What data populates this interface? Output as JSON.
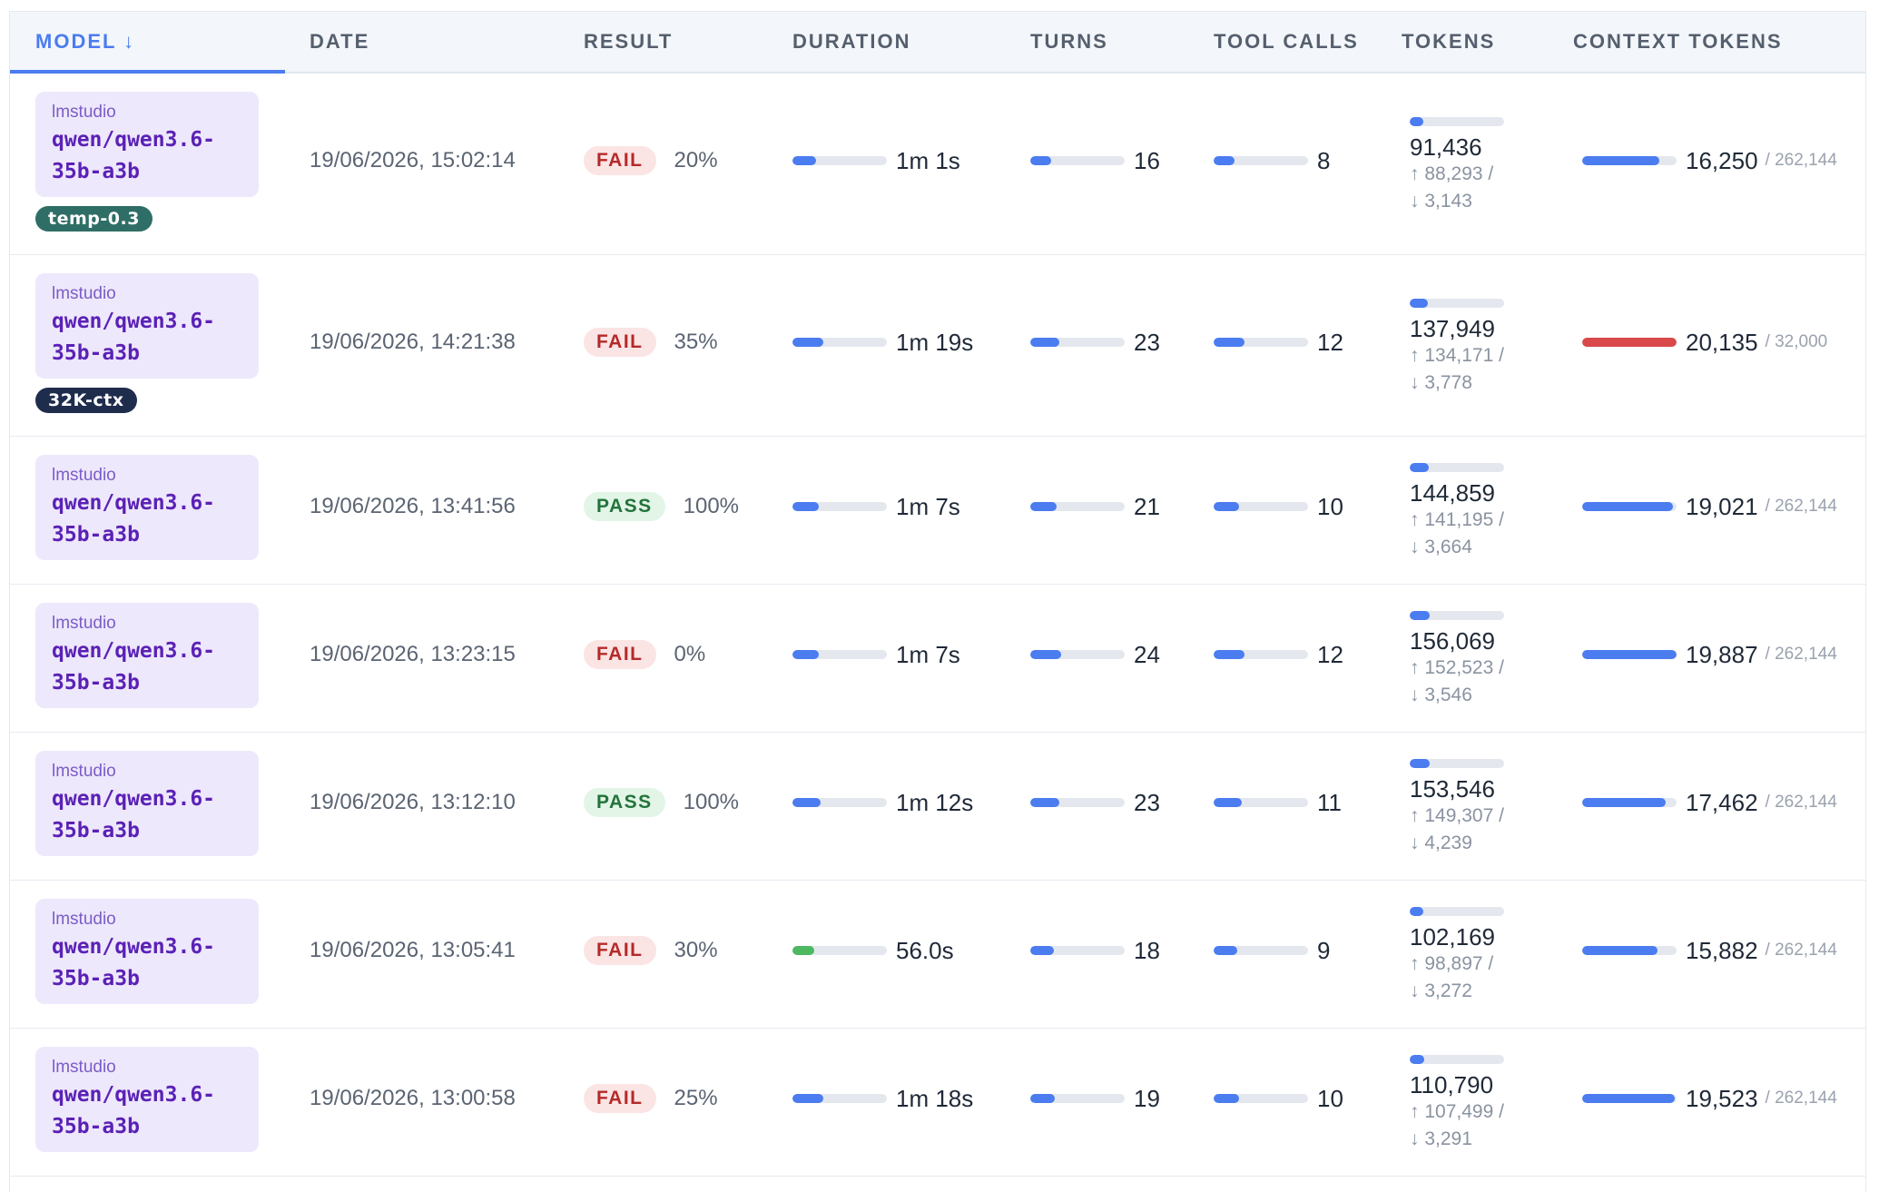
{
  "header": {
    "model_label": "MODEL ↓",
    "date_label": "DATE",
    "result_label": "RESULT",
    "duration_label": "DURATION",
    "turns_label": "TURNS",
    "tool_calls_label": "TOOL CALLS",
    "tokens_label": "TOKENS",
    "context_tokens_label": "CONTEXT TOKENS"
  },
  "colors": {
    "accent": "#4b7cf0",
    "fail_bg": "#fbe4e4",
    "fail_text": "#b52a2a",
    "pass_bg": "#e2f5e7",
    "pass_text": "#23743a",
    "model_card_bg": "#ede8fb",
    "context_over_limit": "#d9484a",
    "duration_fast": "#4cb860"
  },
  "runs": [
    {
      "provider": "lmstudio",
      "model_line1": "qwen/qwen3.6-",
      "model_line2": "35b-a3b",
      "tag": "temp-0.3",
      "tag_color": "#2f6e66",
      "date": "19/06/2026, 15:02:14",
      "result": "FAIL",
      "score": "20%",
      "duration": "1m 1s",
      "duration_fraction": 0.25,
      "duration_color": "#4b7cf0",
      "turns": "16",
      "turns_fraction": 0.22,
      "tool_calls": "8",
      "tool_calls_fraction": 0.22,
      "tokens_total": "91,436",
      "tokens_fraction": 0.14,
      "tokens_in": "↑ 88,293 /",
      "tokens_out": "↓ 3,143",
      "context_tokens": "16,250",
      "context_max": "/ 262,144",
      "context_fraction": 0.82,
      "context_color": "#4b7cf0"
    },
    {
      "provider": "lmstudio",
      "model_line1": "qwen/qwen3.6-",
      "model_line2": "35b-a3b",
      "tag": "32K-ctx",
      "tag_color": "#1f2d4d",
      "date": "19/06/2026, 14:21:38",
      "result": "FAIL",
      "score": "35%",
      "duration": "1m 19s",
      "duration_fraction": 0.33,
      "duration_color": "#4b7cf0",
      "turns": "23",
      "turns_fraction": 0.31,
      "tool_calls": "12",
      "tool_calls_fraction": 0.33,
      "tokens_total": "137,949",
      "tokens_fraction": 0.19,
      "tokens_in": "↑ 134,171 /",
      "tokens_out": "↓ 3,778",
      "context_tokens": "20,135",
      "context_max": "/ 32,000",
      "context_fraction": 1.0,
      "context_color": "#d9484a"
    },
    {
      "provider": "lmstudio",
      "model_line1": "qwen/qwen3.6-",
      "model_line2": "35b-a3b",
      "tag": "",
      "tag_color": "",
      "date": "19/06/2026, 13:41:56",
      "result": "PASS",
      "score": "100%",
      "duration": "1m 7s",
      "duration_fraction": 0.28,
      "duration_color": "#4b7cf0",
      "turns": "21",
      "turns_fraction": 0.28,
      "tool_calls": "10",
      "tool_calls_fraction": 0.27,
      "tokens_total": "144,859",
      "tokens_fraction": 0.2,
      "tokens_in": "↑ 141,195 /",
      "tokens_out": "↓ 3,664",
      "context_tokens": "19,021",
      "context_max": "/ 262,144",
      "context_fraction": 0.96,
      "context_color": "#4b7cf0"
    },
    {
      "provider": "lmstudio",
      "model_line1": "qwen/qwen3.6-",
      "model_line2": "35b-a3b",
      "tag": "",
      "tag_color": "",
      "date": "19/06/2026, 13:23:15",
      "result": "FAIL",
      "score": "0%",
      "duration": "1m 7s",
      "duration_fraction": 0.28,
      "duration_color": "#4b7cf0",
      "turns": "24",
      "turns_fraction": 0.33,
      "tool_calls": "12",
      "tool_calls_fraction": 0.33,
      "tokens_total": "156,069",
      "tokens_fraction": 0.21,
      "tokens_in": "↑ 152,523 /",
      "tokens_out": "↓ 3,546",
      "context_tokens": "19,887",
      "context_max": "/ 262,144",
      "context_fraction": 1.0,
      "context_color": "#4b7cf0"
    },
    {
      "provider": "lmstudio",
      "model_line1": "qwen/qwen3.6-",
      "model_line2": "35b-a3b",
      "tag": "",
      "tag_color": "",
      "date": "19/06/2026, 13:12:10",
      "result": "PASS",
      "score": "100%",
      "duration": "1m 12s",
      "duration_fraction": 0.3,
      "duration_color": "#4b7cf0",
      "turns": "23",
      "turns_fraction": 0.31,
      "tool_calls": "11",
      "tool_calls_fraction": 0.3,
      "tokens_total": "153,546",
      "tokens_fraction": 0.21,
      "tokens_in": "↑ 149,307 /",
      "tokens_out": "↓ 4,239",
      "context_tokens": "17,462",
      "context_max": "/ 262,144",
      "context_fraction": 0.88,
      "context_color": "#4b7cf0"
    },
    {
      "provider": "lmstudio",
      "model_line1": "qwen/qwen3.6-",
      "model_line2": "35b-a3b",
      "tag": "",
      "tag_color": "",
      "date": "19/06/2026, 13:05:41",
      "result": "FAIL",
      "score": "30%",
      "duration": "56.0s",
      "duration_fraction": 0.23,
      "duration_color": "#4cb860",
      "turns": "18",
      "turns_fraction": 0.25,
      "tool_calls": "9",
      "tool_calls_fraction": 0.25,
      "tokens_total": "102,169",
      "tokens_fraction": 0.14,
      "tokens_in": "↑ 98,897 /",
      "tokens_out": "↓ 3,272",
      "context_tokens": "15,882",
      "context_max": "/ 262,144",
      "context_fraction": 0.8,
      "context_color": "#4b7cf0"
    },
    {
      "provider": "lmstudio",
      "model_line1": "qwen/qwen3.6-",
      "model_line2": "35b-a3b",
      "tag": "",
      "tag_color": "",
      "date": "19/06/2026, 13:00:58",
      "result": "FAIL",
      "score": "25%",
      "duration": "1m 18s",
      "duration_fraction": 0.33,
      "duration_color": "#4b7cf0",
      "turns": "19",
      "turns_fraction": 0.26,
      "tool_calls": "10",
      "tool_calls_fraction": 0.27,
      "tokens_total": "110,790",
      "tokens_fraction": 0.15,
      "tokens_in": "↑ 107,499 /",
      "tokens_out": "↓ 3,291",
      "context_tokens": "19,523",
      "context_max": "/ 262,144",
      "context_fraction": 0.98,
      "context_color": "#4b7cf0"
    }
  ]
}
